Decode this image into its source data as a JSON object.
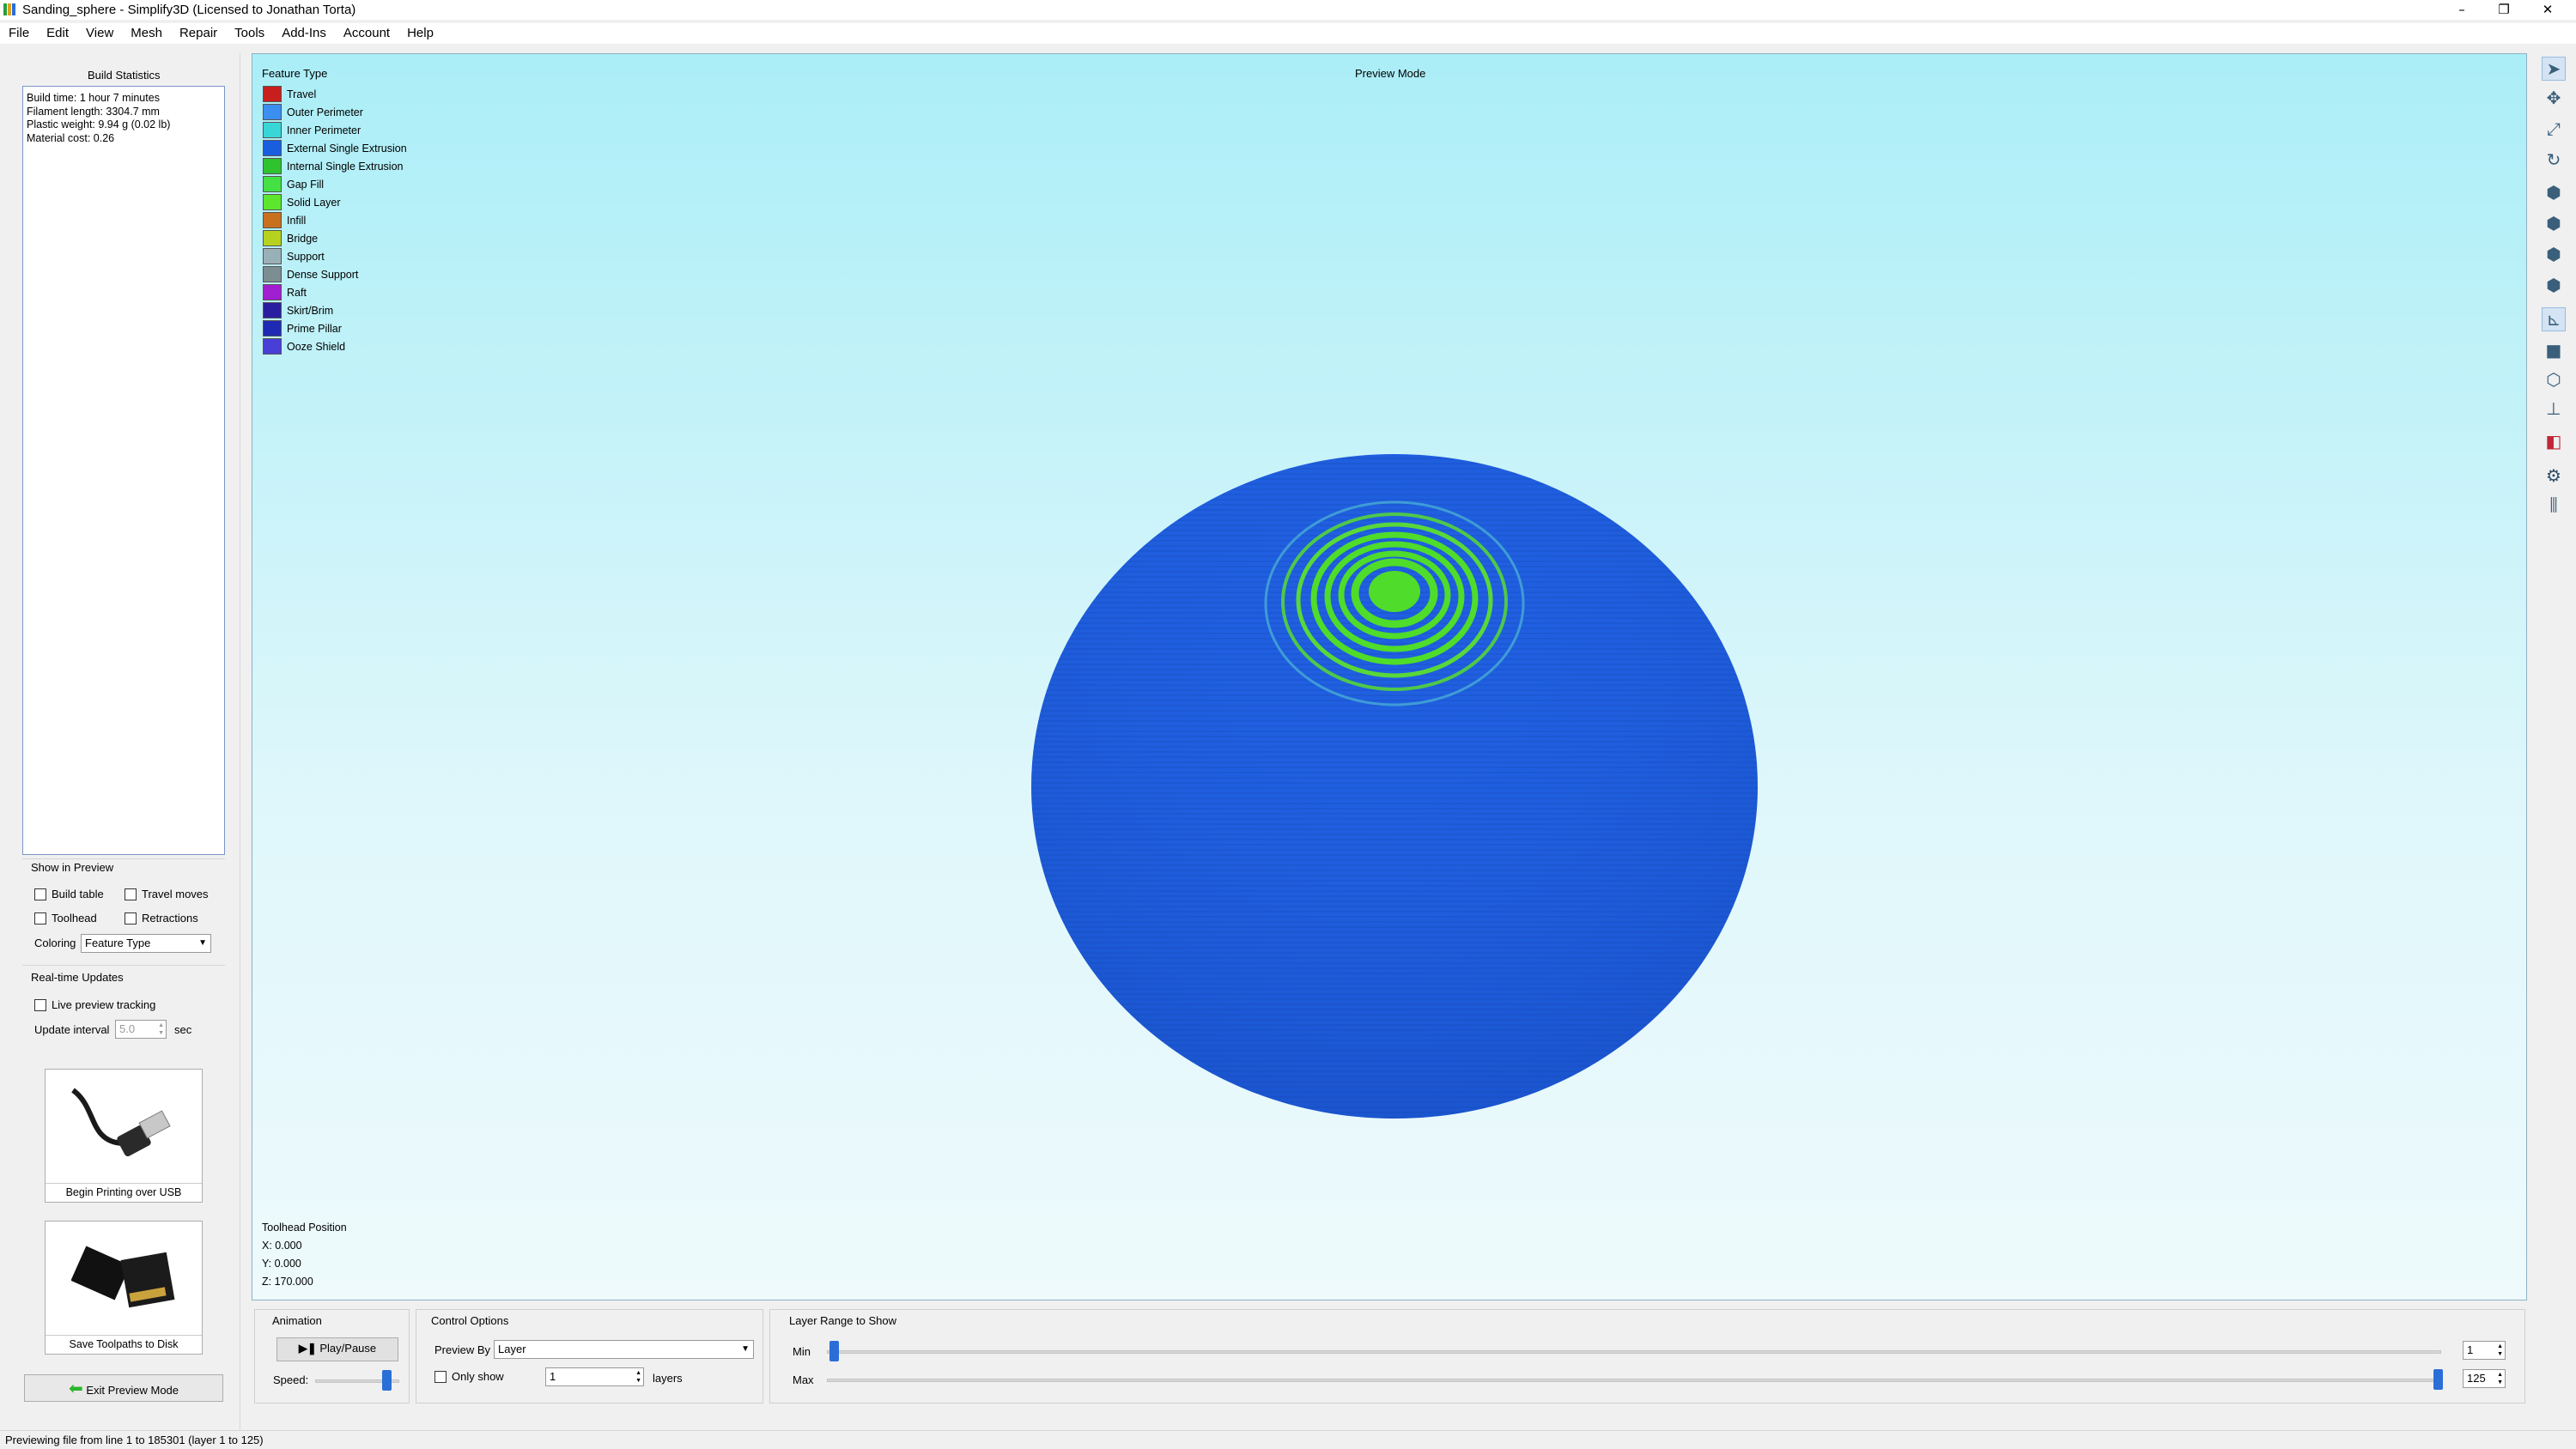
{
  "window": {
    "title": "Sanding_sphere - Simplify3D (Licensed to Jonathan Torta)",
    "controls": {
      "minimize": "–",
      "restore": "❐",
      "close": "✕"
    }
  },
  "menu": [
    "File",
    "Edit",
    "View",
    "Mesh",
    "Repair",
    "Tools",
    "Add-Ins",
    "Account",
    "Help"
  ],
  "build_stats": {
    "header": "Build Statistics",
    "lines": [
      "Build time: 1 hour 7 minutes",
      "Filament length: 3304.7 mm",
      "Plastic weight: 9.94 g (0.02 lb)",
      "Material cost: 0.26"
    ]
  },
  "show_in_preview": {
    "header": "Show in Preview",
    "build_table": "Build table",
    "travel_moves": "Travel moves",
    "toolhead": "Toolhead",
    "retractions": "Retractions",
    "coloring_label": "Coloring",
    "coloring_value": "Feature Type"
  },
  "realtime": {
    "header": "Real-time Updates",
    "live_tracking": "Live preview tracking",
    "interval_label": "Update interval",
    "interval_value": "5.0",
    "interval_unit": "sec"
  },
  "actions": {
    "usb_label": "Begin Printing over USB",
    "disk_label": "Save Toolpaths to Disk",
    "exit_label": "Exit Preview Mode"
  },
  "viewport": {
    "mode_label": "Preview Mode",
    "legend_title": "Feature Type",
    "legend": [
      {
        "label": "Travel",
        "color": "#c81e1e"
      },
      {
        "label": "Outer Perimeter",
        "color": "#3b8ff0"
      },
      {
        "label": "Inner Perimeter",
        "color": "#38d6d6"
      },
      {
        "label": "External Single Extrusion",
        "color": "#1a5ee0"
      },
      {
        "label": "Internal Single Extrusion",
        "color": "#2fc32f"
      },
      {
        "label": "Gap Fill",
        "color": "#44e044"
      },
      {
        "label": "Solid Layer",
        "color": "#5ce62e"
      },
      {
        "label": "Infill",
        "color": "#c8701e"
      },
      {
        "label": "Bridge",
        "color": "#b6d21e"
      },
      {
        "label": "Support",
        "color": "#9ab0b8"
      },
      {
        "label": "Dense Support",
        "color": "#7c8e92"
      },
      {
        "label": "Raft",
        "color": "#a01ed0"
      },
      {
        "label": "Skirt/Brim",
        "color": "#2a1ea0"
      },
      {
        "label": "Prime Pillar",
        "color": "#1e2ab4"
      },
      {
        "label": "Ooze Shield",
        "color": "#4a3ed8"
      }
    ],
    "toolhead": {
      "header": "Toolhead Position",
      "x": "X: 0.000",
      "y": "Y: 0.000",
      "z": "Z: 170.000"
    }
  },
  "animation": {
    "header": "Animation",
    "play_label": "Play/Pause",
    "speed_label": "Speed:"
  },
  "control_options": {
    "header": "Control Options",
    "preview_by_label": "Preview By",
    "preview_by_value": "Layer",
    "only_show_label": "Only show",
    "only_show_value": "1",
    "layers_label": "layers"
  },
  "layer_range": {
    "header": "Layer Range to Show",
    "min_label": "Min",
    "min_value": "1",
    "max_label": "Max",
    "max_value": "125"
  },
  "status": "Previewing file from line 1 to 185301 (layer 1 to 125)",
  "colors": {
    "model_blue": "#1f5fe0",
    "model_green": "#4fdc2a",
    "viewport_top": "#abeef7"
  }
}
